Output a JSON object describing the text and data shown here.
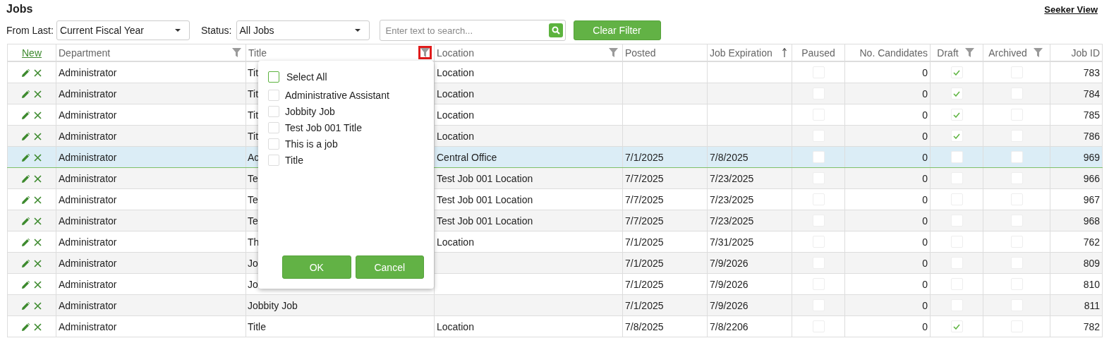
{
  "page_title": "Jobs",
  "seeker_view_link": "Seeker View",
  "filters": {
    "from_last": {
      "label": "From Last:",
      "value": "Current Fiscal Year"
    },
    "status": {
      "label": "Status:",
      "value": "All Jobs"
    },
    "search": {
      "placeholder": "Enter text to search..."
    },
    "clear_button": "Clear Filter"
  },
  "table": {
    "new_link": "New",
    "columns": [
      {
        "label": "Department",
        "kind": "text",
        "filter": true,
        "filter_open": false,
        "sorted": false
      },
      {
        "label": "Title",
        "kind": "text",
        "filter": true,
        "filter_open": true,
        "sorted": false
      },
      {
        "label": "Location",
        "kind": "text",
        "filter": true,
        "filter_open": false,
        "sorted": false
      },
      {
        "label": "Posted",
        "kind": "text",
        "filter": false,
        "sorted": false
      },
      {
        "label": "Job Expiration",
        "kind": "text",
        "filter": false,
        "sorted": true
      },
      {
        "label": "Paused",
        "kind": "check",
        "filter": false,
        "sorted": false
      },
      {
        "label": "No. Candidates",
        "kind": "number",
        "filter": false,
        "sorted": false
      },
      {
        "label": "Draft",
        "kind": "check",
        "filter": true,
        "filter_open": false,
        "sorted": false
      },
      {
        "label": "Archived",
        "kind": "check",
        "filter": true,
        "filter_open": false,
        "sorted": false
      },
      {
        "label": "Job ID",
        "kind": "number",
        "filter": false,
        "sorted": false
      }
    ],
    "rows": [
      {
        "selected": false,
        "cells": [
          "Administrator",
          "Tit",
          "Location",
          null,
          null,
          false,
          "0",
          true,
          false,
          "783"
        ]
      },
      {
        "selected": false,
        "cells": [
          "Administrator",
          "Tit",
          "Location",
          null,
          null,
          false,
          "0",
          true,
          false,
          "784"
        ]
      },
      {
        "selected": false,
        "cells": [
          "Administrator",
          "Tit",
          "Location",
          null,
          null,
          false,
          "0",
          true,
          false,
          "785"
        ]
      },
      {
        "selected": false,
        "cells": [
          "Administrator",
          "Tit",
          "Location",
          null,
          null,
          false,
          "0",
          true,
          false,
          "786"
        ]
      },
      {
        "selected": true,
        "cells": [
          "Administrator",
          "Ac",
          "Central Office",
          "7/1/2025",
          "7/8/2025",
          false,
          "0",
          false,
          false,
          "969"
        ]
      },
      {
        "selected": false,
        "cells": [
          "Administrator",
          "Te",
          "Test Job 001 Location",
          "7/7/2025",
          "7/23/2025",
          false,
          "0",
          false,
          false,
          "966"
        ]
      },
      {
        "selected": false,
        "cells": [
          "Administrator",
          "Te",
          "Test Job 001 Location",
          "7/7/2025",
          "7/23/2025",
          false,
          "0",
          false,
          false,
          "967"
        ]
      },
      {
        "selected": false,
        "cells": [
          "Administrator",
          "Te",
          "Test Job 001 Location",
          "7/7/2025",
          "7/23/2025",
          false,
          "0",
          false,
          false,
          "968"
        ]
      },
      {
        "selected": false,
        "cells": [
          "Administrator",
          "Th",
          "Location",
          "7/1/2025",
          "7/31/2025",
          false,
          "0",
          false,
          false,
          "762"
        ]
      },
      {
        "selected": false,
        "cells": [
          "Administrator",
          "Jo",
          null,
          "7/1/2025",
          "7/9/2026",
          false,
          "0",
          false,
          false,
          "809"
        ]
      },
      {
        "selected": false,
        "cells": [
          "Administrator",
          "Jo",
          null,
          "7/1/2025",
          "7/9/2026",
          false,
          "0",
          false,
          false,
          "810"
        ]
      },
      {
        "selected": false,
        "cells": [
          "Administrator",
          "Jobbity Job",
          null,
          "7/1/2025",
          "7/9/2026",
          false,
          "0",
          false,
          false,
          "811"
        ]
      },
      {
        "selected": false,
        "cells": [
          "Administrator",
          "Title",
          "Location",
          "7/8/2025",
          "7/8/2206",
          false,
          "0",
          true,
          false,
          "782"
        ]
      }
    ]
  },
  "filter_popup": {
    "select_all": {
      "label": "Select All",
      "checked": false
    },
    "options": [
      {
        "label": "Administrative Assistant",
        "checked": false
      },
      {
        "label": "Jobbity Job",
        "checked": false
      },
      {
        "label": "Test Job 001 Title",
        "checked": false
      },
      {
        "label": "This is a job",
        "checked": false
      },
      {
        "label": "Title",
        "checked": false
      }
    ],
    "ok_button": "OK",
    "cancel_button": "Cancel"
  }
}
